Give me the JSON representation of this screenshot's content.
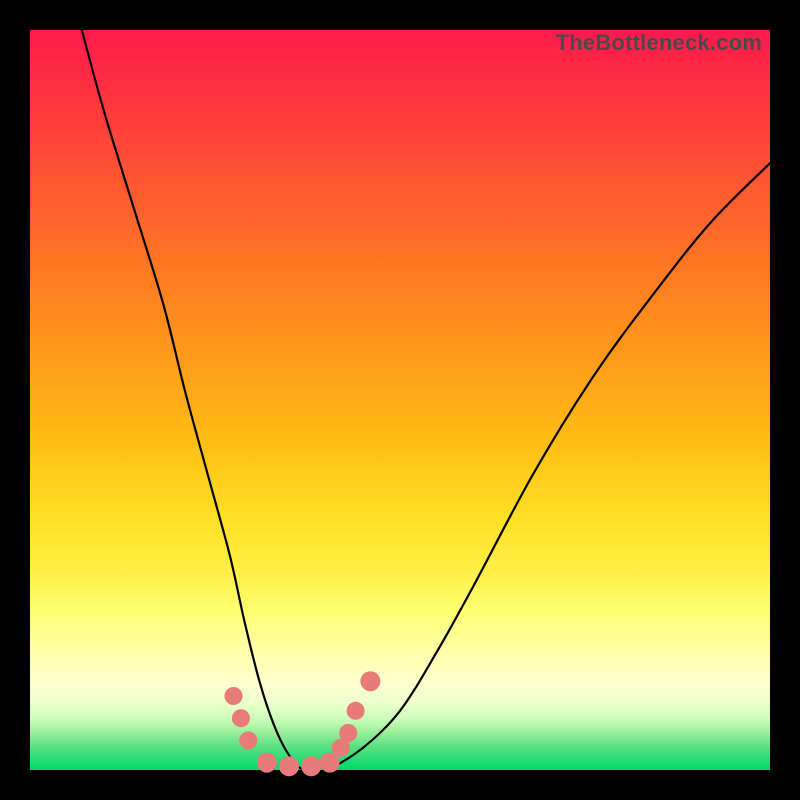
{
  "watermark": "TheBottleneck.com",
  "chart_data": {
    "type": "line",
    "title": "",
    "xlabel": "",
    "ylabel": "",
    "xlim": [
      0,
      100
    ],
    "ylim": [
      0,
      100
    ],
    "series": [
      {
        "name": "bottleneck-curve",
        "x": [
          7,
          10,
          14,
          18,
          21,
          24,
          27,
          29,
          31,
          33,
          35,
          37,
          40,
          45,
          50,
          55,
          60,
          68,
          76,
          84,
          92,
          100
        ],
        "values": [
          100,
          89,
          76,
          63,
          51,
          40,
          29,
          20,
          12,
          6,
          2,
          0,
          0,
          3,
          8,
          16,
          25,
          40,
          53,
          64,
          74,
          82
        ]
      }
    ],
    "markers": {
      "name": "highlight-points",
      "color": "#e87a7a",
      "points": [
        {
          "x": 27.5,
          "y": 10,
          "r": 9
        },
        {
          "x": 28.5,
          "y": 7,
          "r": 9
        },
        {
          "x": 29.5,
          "y": 4,
          "r": 9
        },
        {
          "x": 32,
          "y": 1,
          "r": 10
        },
        {
          "x": 35,
          "y": 0.5,
          "r": 10
        },
        {
          "x": 38,
          "y": 0.5,
          "r": 10
        },
        {
          "x": 40.5,
          "y": 1,
          "r": 10
        },
        {
          "x": 42,
          "y": 3,
          "r": 9
        },
        {
          "x": 43,
          "y": 5,
          "r": 9
        },
        {
          "x": 44,
          "y": 8,
          "r": 9
        },
        {
          "x": 46,
          "y": 12,
          "r": 10
        }
      ]
    }
  }
}
